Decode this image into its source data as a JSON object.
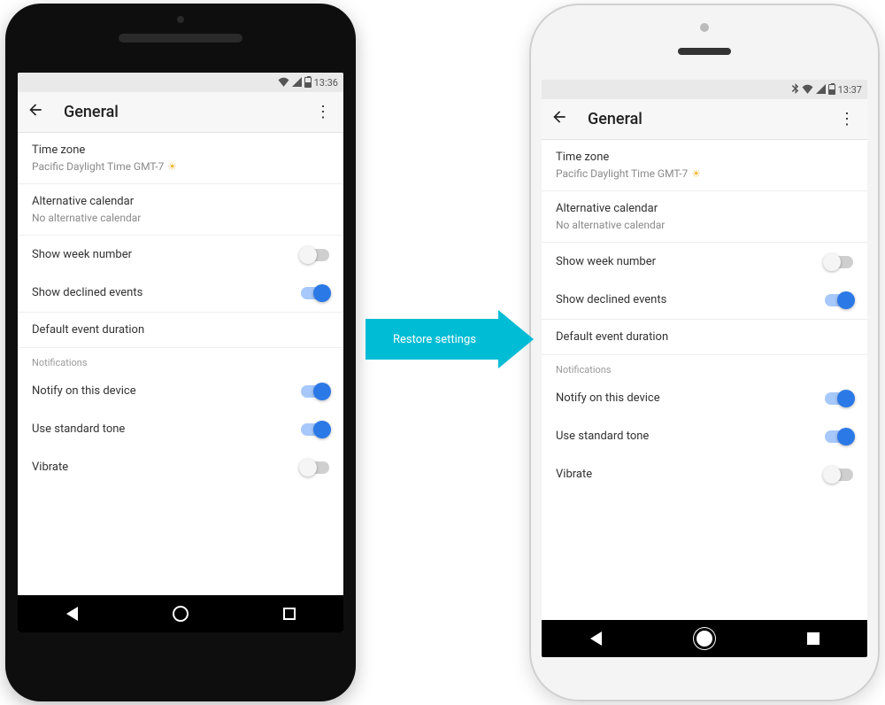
{
  "arrow_label": "Restore settings",
  "phones": {
    "left": {
      "status": {
        "time": "13:36",
        "bluetooth": false
      },
      "title": "General",
      "timezone": {
        "label": "Time zone",
        "value": "Pacific Daylight Time  GMT-7"
      },
      "alt_cal": {
        "label": "Alternative calendar",
        "value": "No alternative calendar"
      },
      "week_number": {
        "label": "Show week number",
        "on": false
      },
      "declined": {
        "label": "Show declined events",
        "on": true
      },
      "default_dur": {
        "label": "Default event duration"
      },
      "notif_header": "Notifications",
      "notify": {
        "label": "Notify on this device",
        "on": true
      },
      "std_tone": {
        "label": "Use standard tone",
        "on": true
      },
      "vibrate": {
        "label": "Vibrate",
        "on": false
      }
    },
    "right": {
      "status": {
        "time": "13:37",
        "bluetooth": true
      },
      "title": "General",
      "timezone": {
        "label": "Time zone",
        "value": "Pacific Daylight Time  GMT-7"
      },
      "alt_cal": {
        "label": "Alternative calendar",
        "value": "No alternative calendar"
      },
      "week_number": {
        "label": "Show week number",
        "on": false
      },
      "declined": {
        "label": "Show declined events",
        "on": true
      },
      "default_dur": {
        "label": "Default event duration"
      },
      "notif_header": "Notifications",
      "notify": {
        "label": "Notify on this device",
        "on": true
      },
      "std_tone": {
        "label": "Use standard tone",
        "on": true
      },
      "vibrate": {
        "label": "Vibrate",
        "on": false
      }
    }
  }
}
